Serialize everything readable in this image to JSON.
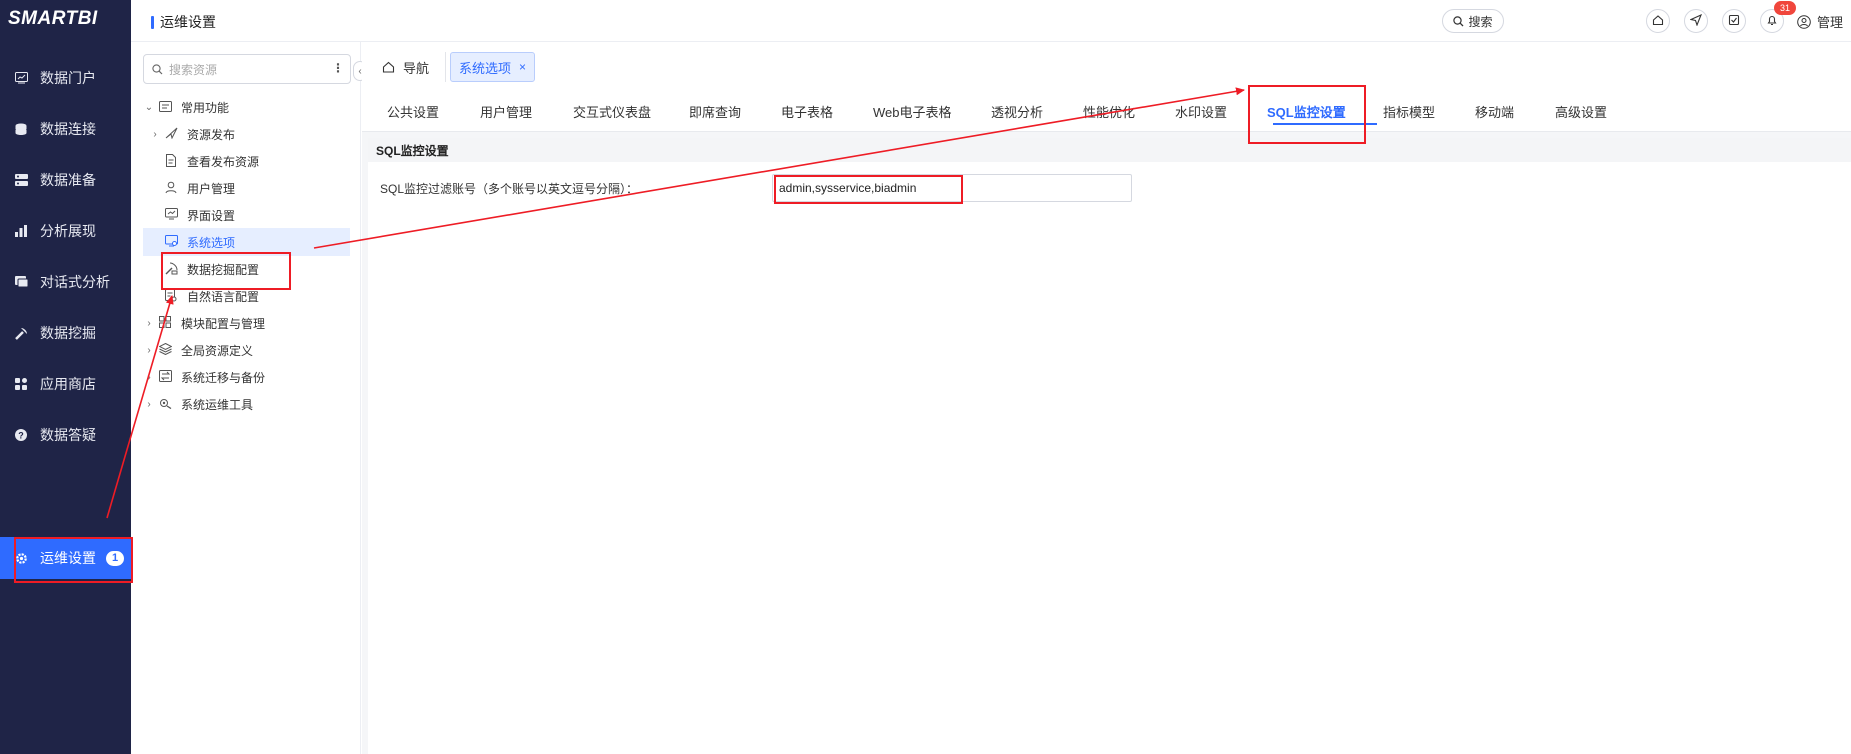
{
  "app": {
    "logo": "SMARTBI"
  },
  "leftnav": {
    "items": [
      {
        "label": "数据门户",
        "icon": "monitor-icon"
      },
      {
        "label": "数据连接",
        "icon": "database-icon"
      },
      {
        "label": "数据准备",
        "icon": "server-icon"
      },
      {
        "label": "分析展现",
        "icon": "bar-chart-icon"
      },
      {
        "label": "对话式分析",
        "icon": "chat-icon"
      },
      {
        "label": "数据挖掘",
        "icon": "pickaxe-icon"
      },
      {
        "label": "应用商店",
        "icon": "grid-icon"
      },
      {
        "label": "数据答疑",
        "icon": "question-icon"
      },
      {
        "label": "运维设置",
        "icon": "gear-icon",
        "badge": "1",
        "active": true
      }
    ]
  },
  "topbar": {
    "breadcrumb": "运维设置",
    "search_label": "搜索",
    "notification_count": "31",
    "user_label": "管理"
  },
  "tree": {
    "search_placeholder": "搜索资源",
    "items": [
      {
        "label": "常用功能",
        "arrow": "⌄",
        "icon": "folder-icon"
      },
      {
        "label": "资源发布",
        "arrow": "›",
        "icon": "send-icon"
      },
      {
        "label": "查看发布资源",
        "arrow": "",
        "icon": "doc-icon"
      },
      {
        "label": "用户管理",
        "arrow": "",
        "icon": "user-icon"
      },
      {
        "label": "界面设置",
        "arrow": "",
        "icon": "screen-icon"
      },
      {
        "label": "系统选项",
        "arrow": "",
        "icon": "system-icon",
        "selected": true
      },
      {
        "label": "数据挖掘配置",
        "arrow": "",
        "icon": "mining-icon"
      },
      {
        "label": "自然语言配置",
        "arrow": "",
        "icon": "nlp-icon"
      },
      {
        "label": "模块配置与管理",
        "arrow": "›",
        "icon": "modules-icon"
      },
      {
        "label": "全局资源定义",
        "arrow": "›",
        "icon": "layers-icon"
      },
      {
        "label": "系统迁移与备份",
        "arrow": "›",
        "icon": "migrate-icon"
      },
      {
        "label": "系统运维工具",
        "arrow": "›",
        "icon": "tools-icon"
      }
    ]
  },
  "tabs": {
    "nav_label": "导航",
    "open_tab": "系统选项",
    "close_symbol": "×"
  },
  "subtabs": [
    {
      "label": "公共设置"
    },
    {
      "label": "用户管理"
    },
    {
      "label": "交互式仪表盘"
    },
    {
      "label": "即席查询"
    },
    {
      "label": "电子表格"
    },
    {
      "label": "Web电子表格"
    },
    {
      "label": "透视分析"
    },
    {
      "label": "性能优化"
    },
    {
      "label": "水印设置"
    },
    {
      "label": "SQL监控设置",
      "active": true
    },
    {
      "label": "指标模型"
    },
    {
      "label": "移动端"
    },
    {
      "label": "高级设置"
    }
  ],
  "content": {
    "section_title": "SQL监控设置",
    "field_label": "SQL监控过滤账号（多个账号以英文逗号分隔）：",
    "field_value": "admin,sysservice,biadmin"
  },
  "colors": {
    "accent": "#2f6bff",
    "nav_bg": "#1f2447",
    "annotation": "#ee1c25"
  }
}
